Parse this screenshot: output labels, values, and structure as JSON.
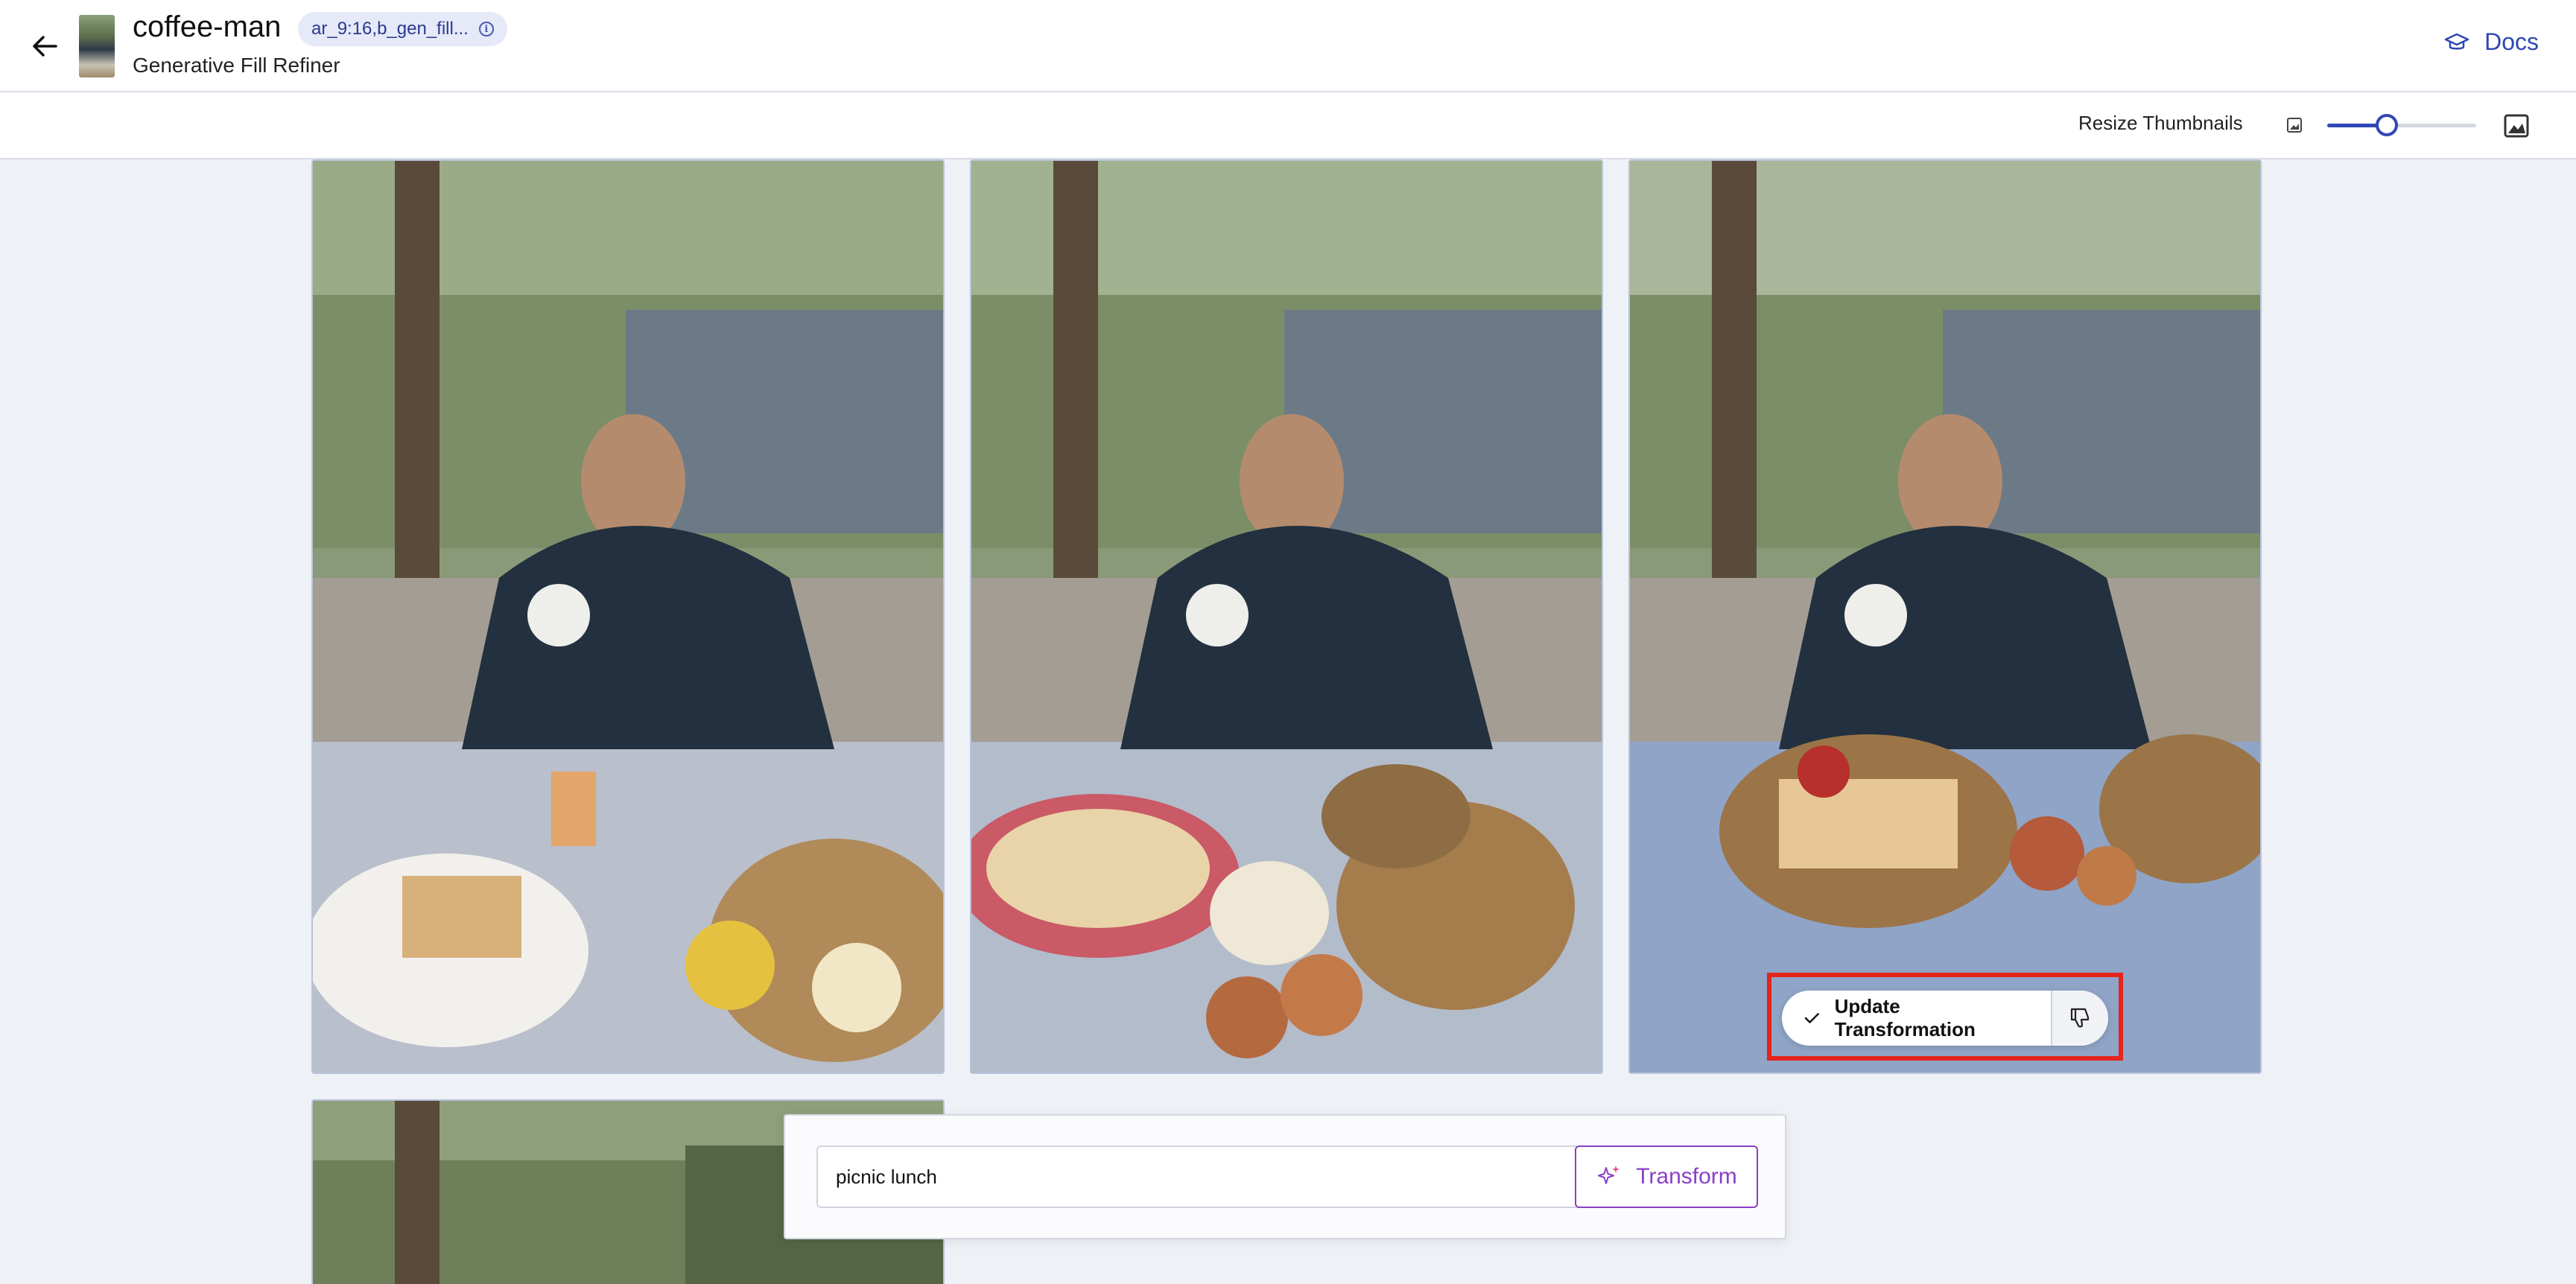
{
  "header": {
    "title": "coffee-man",
    "subtitle": "Generative Fill Refiner",
    "transform_chip": "ar_9:16,b_gen_fill...",
    "docs_label": "Docs"
  },
  "toolbar": {
    "resize_label": "Resize Thumbnails",
    "thumbnail_size": 0.4
  },
  "results": {
    "items": [
      {
        "variant": "picnic plate with bread, cheese and juice"
      },
      {
        "variant": "plaid picnic cloth with baskets and pastries"
      },
      {
        "variant": "blue tablecloth with wicker basket of toast"
      },
      {
        "variant": "partially visible fourth result"
      }
    ],
    "update_label": "Update Transformation"
  },
  "prompt": {
    "value": "picnic lunch",
    "transform_label": "Transform"
  },
  "colors": {
    "accent": "#3047b5",
    "transform": "#8a3fc7",
    "highlight": "#e5241b"
  }
}
